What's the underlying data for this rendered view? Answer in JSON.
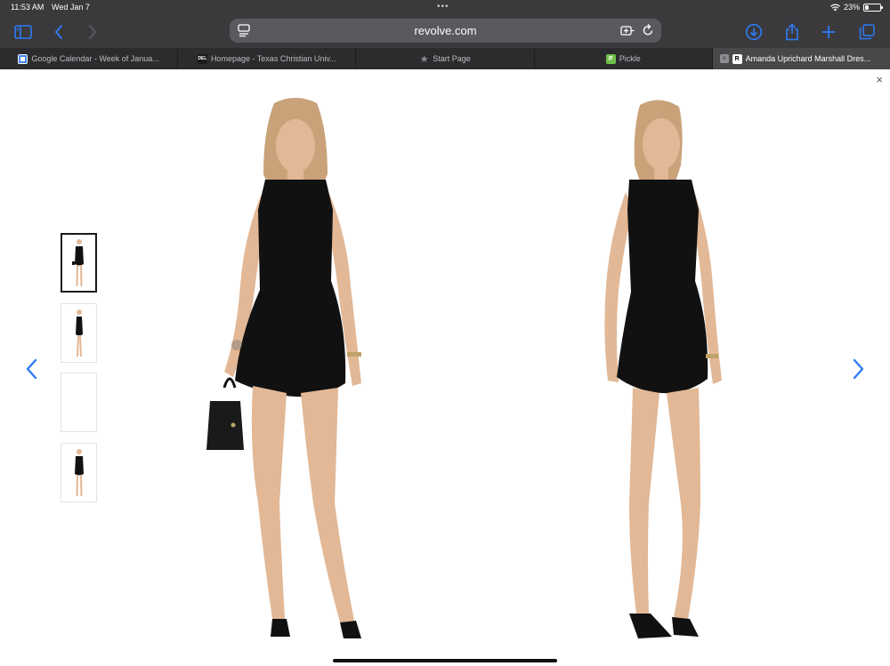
{
  "status": {
    "time": "11:53 AM",
    "date": "Wed Jan 7",
    "battery": "23%",
    "battery_level": 0.23
  },
  "browser": {
    "address": "revolve.com",
    "tabs": [
      {
        "label": "Google Calendar - Week of Janua...",
        "favicon": "calendar-icon",
        "favicon_color": "#4285f4",
        "active": false
      },
      {
        "label": "Homepage - Texas Christian Univ...",
        "favicon": "tcu-icon",
        "favicon_color": "#ffffff",
        "active": false
      },
      {
        "label": "Start Page",
        "favicon": "star-icon",
        "favicon_color": "#8e8e93",
        "active": false
      },
      {
        "label": "Pickle",
        "favicon": "pickle-icon",
        "favicon_color": "#6fbf4a",
        "active": false
      },
      {
        "label": "Amanda Uprichard Marshall Dres...",
        "favicon": "revolve-icon",
        "favicon_color": "#ffffff",
        "active": true
      }
    ],
    "favicon_text": {
      "tcu": "DEL",
      "pickle": "P",
      "revolve": "R"
    }
  },
  "viewer": {
    "close": "×",
    "thumbnails": [
      {
        "name": "front view",
        "selected": true
      },
      {
        "name": "side view",
        "selected": false
      },
      {
        "name": "blank",
        "selected": false
      },
      {
        "name": "front view 2",
        "selected": false
      }
    ],
    "prev_icon": "chevron-left-icon",
    "next_icon": "chevron-right-icon"
  },
  "colors": {
    "accent": "#2f7bf5",
    "chrome": "#3a3a3c",
    "dress": "#111111",
    "skin": "#e2b896",
    "hair": "#c9a27a"
  }
}
